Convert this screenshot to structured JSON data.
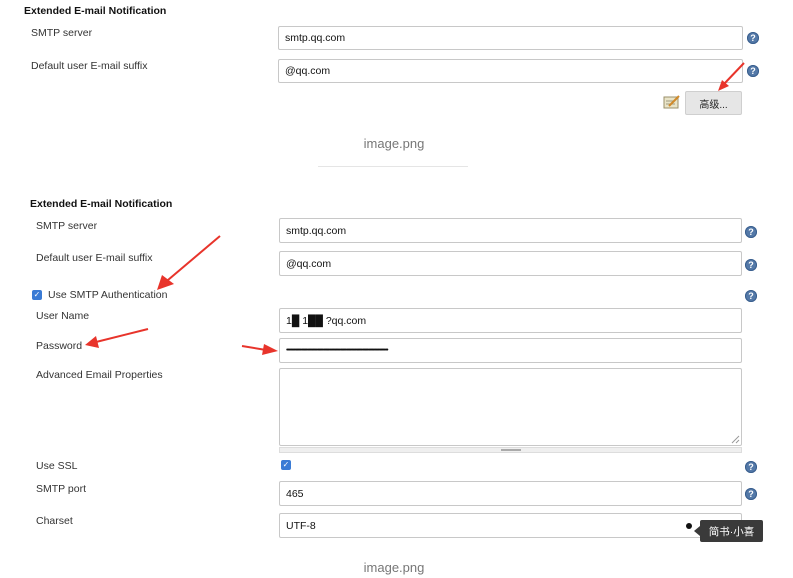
{
  "panel1": {
    "title": "Extended E-mail Notification",
    "smtp_server_label": "SMTP server",
    "smtp_server_value": "smtp.qq.com",
    "suffix_label": "Default user E-mail suffix",
    "suffix_value": "@qq.com",
    "advanced_button": "高级..."
  },
  "caption1": "image.png",
  "panel2": {
    "title": "Extended E-mail Notification",
    "smtp_server_label": "SMTP server",
    "smtp_server_value": "smtp.qq.com",
    "suffix_label": "Default user E-mail suffix",
    "suffix_value": "@qq.com",
    "use_auth_label": "Use SMTP Authentication",
    "use_auth_checked": true,
    "username_label": "User Name",
    "username_value": "1█ 1██ ?qq.com",
    "password_label": "Password",
    "password_value": "••••••••••••••••••••••••••••••••••••••••••••••••••••••••••••••••••••••••••••••••••••••••",
    "adv_props_label": "Advanced Email Properties",
    "adv_props_value": "",
    "use_ssl_label": "Use SSL",
    "use_ssl_checked": true,
    "smtp_port_label": "SMTP port",
    "smtp_port_value": "465",
    "charset_label": "Charset",
    "charset_value": "UTF-8"
  },
  "tooltip_text": "简书·小喜",
  "caption2": "image.png",
  "colors": {
    "help_icon": "#5479a8",
    "arrow": "#e8342b",
    "checkbox": "#3a7bd5"
  },
  "icons": {
    "help": "question-mark-circle",
    "notepad": "notepad-pencil",
    "annotation": "red-arrow"
  }
}
